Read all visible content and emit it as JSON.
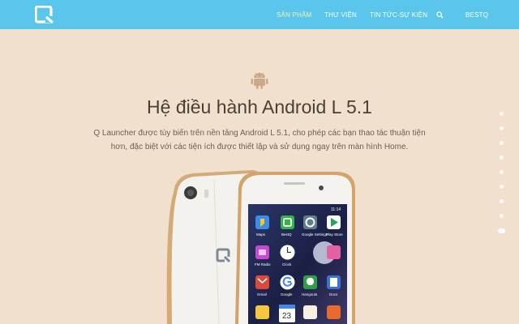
{
  "nav": {
    "items": [
      {
        "id": "san-pham",
        "label": "SẢN PHẨM",
        "active": true
      },
      {
        "id": "thu-vien",
        "label": "THƯ VIỆN",
        "active": false
      },
      {
        "id": "tin-tuc",
        "label": "TIN TỨC-SỰ KIỆN",
        "active": false
      },
      {
        "id": "bestq",
        "label": "BESTQ",
        "active": false
      }
    ],
    "search_icon": "search-icon",
    "logo": "q-logo"
  },
  "hero": {
    "icon": "android-icon",
    "title": "Hệ điều hành Android L 5.1",
    "description_line1": "Q Launcher được tùy biến trên nền tảng Android L 5.1, cho phép các bạn thao tác thuận tiện",
    "description_line2": "hơn, đặc biệt với các tiện ích được thiết lập và sử dụng ngay trên màn hình Home."
  },
  "pagination": {
    "count": 9,
    "active_index": 8
  },
  "phone": {
    "status_time": "11:14",
    "clock": "12",
    "calendar_day": "23",
    "apps": [
      {
        "label": "Maps",
        "color": "#3b8ee8"
      },
      {
        "label": "BestQ",
        "color": "#34b34a"
      },
      {
        "label": "Google Settings",
        "color": "#607d8b"
      },
      {
        "label": "Play Store",
        "color": "#ffffff"
      },
      {
        "label": "FM Radio",
        "color": "#c34bd0"
      },
      {
        "label": "Clock",
        "color": "#ffffff"
      },
      {
        "label": "Gmail",
        "color": "#d94a3a"
      },
      {
        "label": "Google",
        "color": "#ffffff"
      },
      {
        "label": "Hangouts",
        "color": "#2e9e4b"
      },
      {
        "label": "Docs",
        "color": "#3a72d8"
      }
    ]
  },
  "colors": {
    "nav_bg": "#5bc6ec",
    "page_bg": "#f1e0cd",
    "nav_active": "#f7f1a3",
    "title_text": "#4a3f37"
  }
}
